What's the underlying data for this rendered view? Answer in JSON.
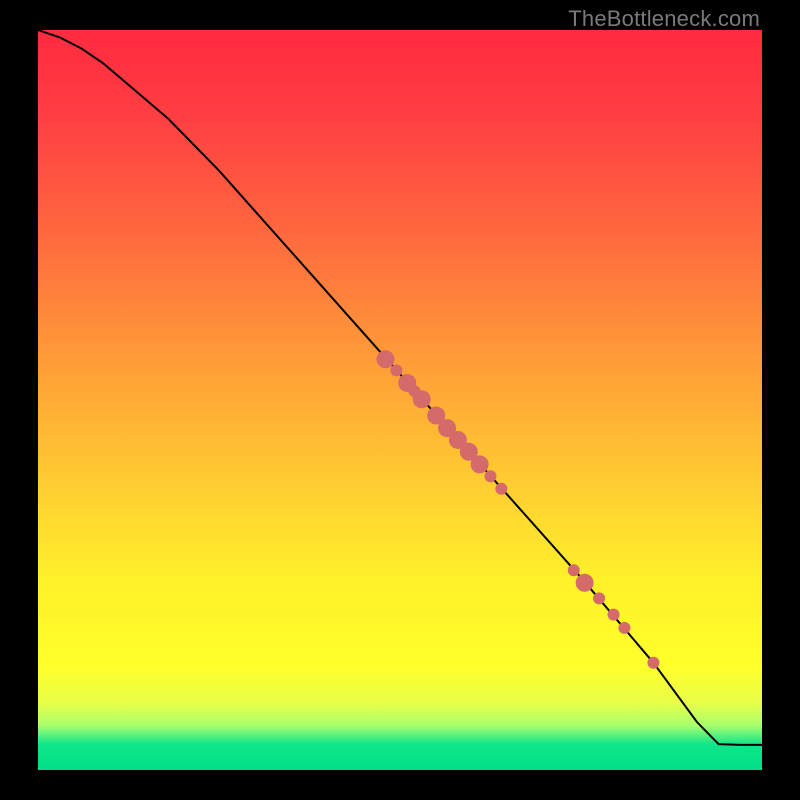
{
  "watermark": "TheBottleneck.com",
  "chart_data": {
    "type": "line",
    "title": "",
    "xlabel": "",
    "ylabel": "",
    "xlim": [
      0,
      100
    ],
    "ylim": [
      0,
      100
    ],
    "grid": false,
    "legend": false,
    "series": [
      {
        "name": "curve",
        "x": [
          0,
          3,
          6,
          9,
          12,
          18,
          25,
          35,
          45,
          55,
          65,
          75,
          85,
          91,
          94,
          97,
          100
        ],
        "y": [
          100,
          99,
          97.5,
          95.5,
          93,
          88,
          81,
          70,
          59,
          48,
          37,
          26,
          14.5,
          6.5,
          3.5,
          3.4,
          3.4
        ],
        "stroke": "#000000",
        "stroke_width": 2
      }
    ],
    "markers": {
      "name": "highlighted-points",
      "color": "#d46a6a",
      "radius_small": 6,
      "radius_large": 9,
      "points": [
        {
          "x": 48,
          "y": 55.5,
          "r": "large"
        },
        {
          "x": 49.5,
          "y": 54,
          "r": "small"
        },
        {
          "x": 51,
          "y": 52.3,
          "r": "large"
        },
        {
          "x": 52,
          "y": 51.2,
          "r": "small"
        },
        {
          "x": 53,
          "y": 50.1,
          "r": "large"
        },
        {
          "x": 55,
          "y": 47.9,
          "r": "large"
        },
        {
          "x": 56.5,
          "y": 46.2,
          "r": "large"
        },
        {
          "x": 58,
          "y": 44.6,
          "r": "large"
        },
        {
          "x": 59.5,
          "y": 43,
          "r": "large"
        },
        {
          "x": 61,
          "y": 41.3,
          "r": "large"
        },
        {
          "x": 62.5,
          "y": 39.7,
          "r": "small"
        },
        {
          "x": 64,
          "y": 38,
          "r": "small"
        },
        {
          "x": 74,
          "y": 27,
          "r": "small"
        },
        {
          "x": 75.5,
          "y": 25.3,
          "r": "large"
        },
        {
          "x": 77.5,
          "y": 23.2,
          "r": "small"
        },
        {
          "x": 79.5,
          "y": 21,
          "r": "small"
        },
        {
          "x": 81,
          "y": 19.2,
          "r": "small"
        },
        {
          "x": 85,
          "y": 14.5,
          "r": "small"
        }
      ]
    }
  }
}
